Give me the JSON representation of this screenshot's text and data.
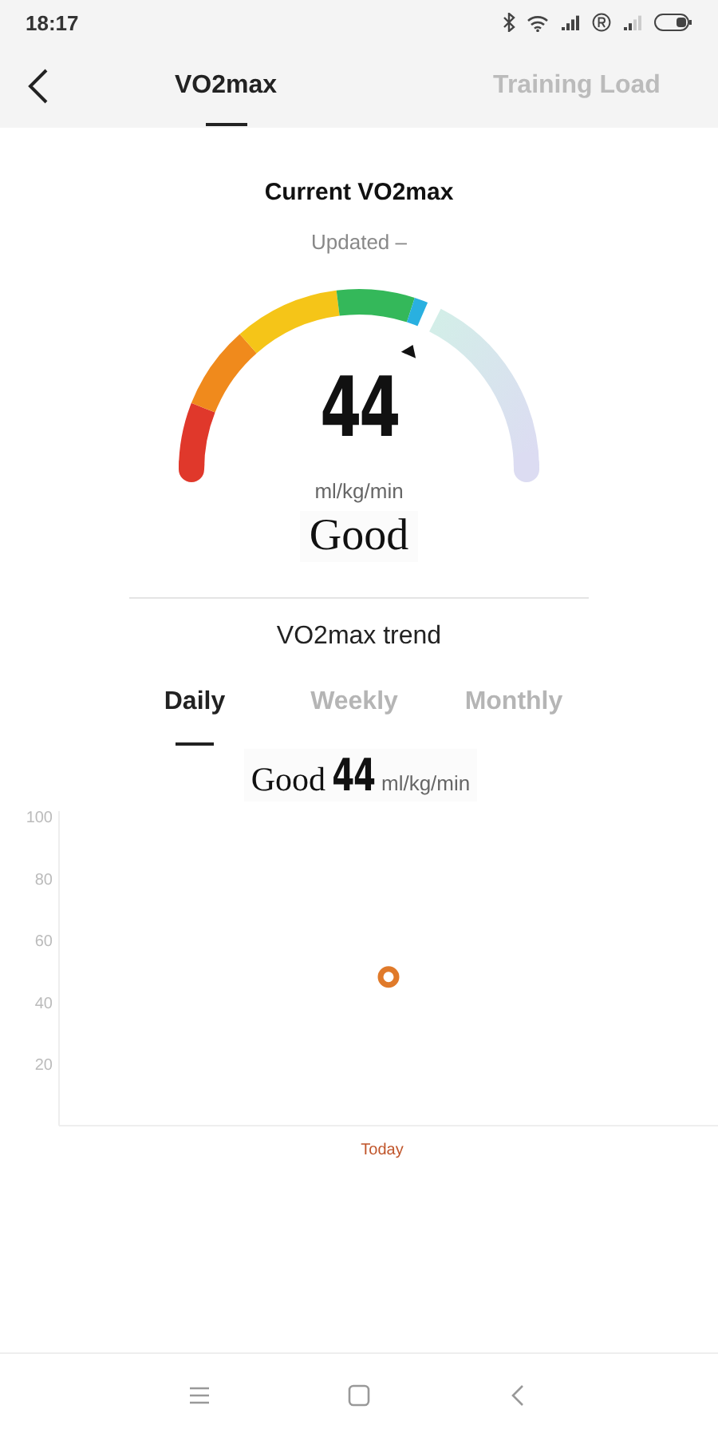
{
  "status_bar": {
    "time": "18:17"
  },
  "header": {
    "tabs": [
      {
        "label": "VO2max",
        "selected": true
      },
      {
        "label": "Training Load",
        "selected": false
      }
    ]
  },
  "current": {
    "title": "Current VO2max",
    "updated": "Updated –",
    "value": "44",
    "unit": "ml/kg/min",
    "rating": "Good"
  },
  "trend": {
    "title": "VO2max trend",
    "periods": [
      {
        "label": "Daily",
        "selected": true
      },
      {
        "label": "Weekly",
        "selected": false
      },
      {
        "label": "Monthly",
        "selected": false
      }
    ],
    "summary": {
      "rating": "Good",
      "value": "44",
      "unit": "ml/kg/min"
    },
    "chart_data": {
      "type": "scatter",
      "categories": [
        "Today"
      ],
      "series": [
        {
          "color": "#e07a2a",
          "values": [
            48
          ]
        }
      ],
      "ylim": [
        0,
        100
      ],
      "yticks": [
        20,
        40,
        60,
        80,
        100
      ]
    }
  }
}
